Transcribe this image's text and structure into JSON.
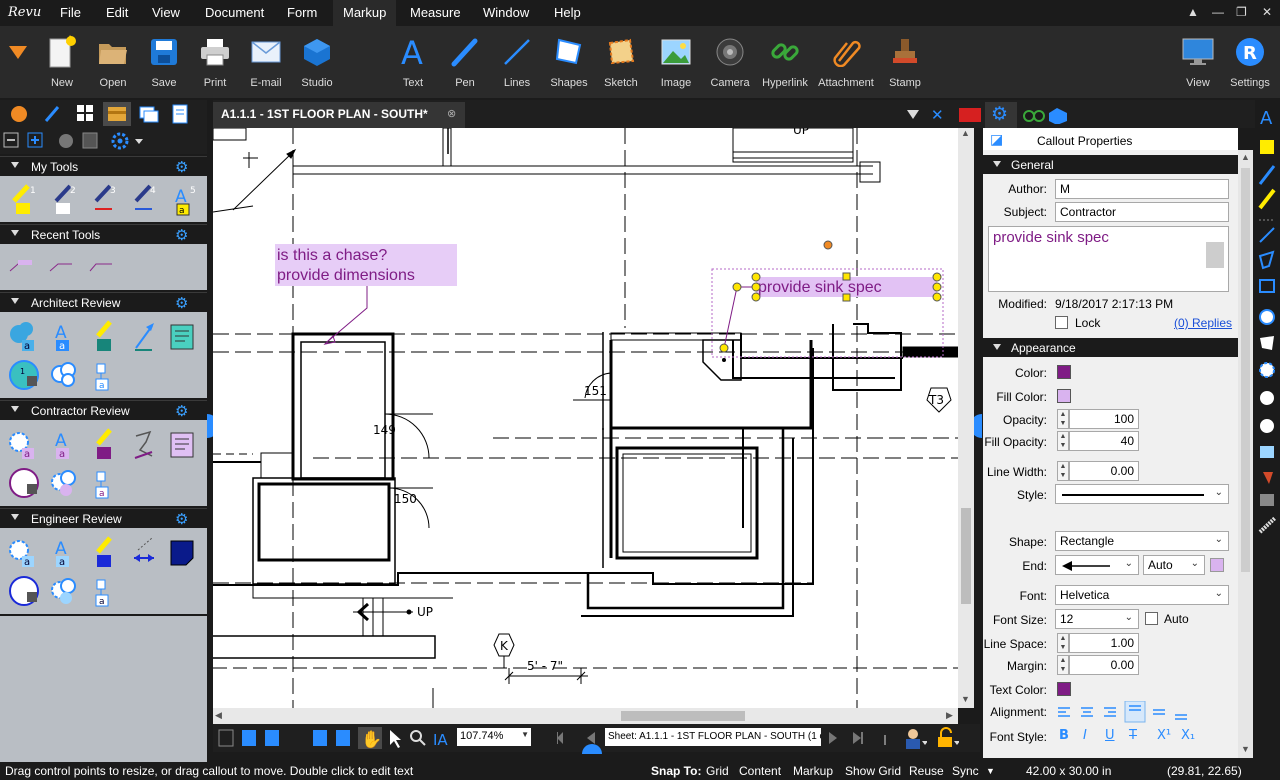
{
  "app": {
    "logo": "Revu"
  },
  "menu": [
    "File",
    "Edit",
    "View",
    "Document",
    "Form",
    "Markup",
    "Measure",
    "Window",
    "Help"
  ],
  "window_controls": [
    "▲",
    "—",
    "❐",
    "✕"
  ],
  "ribbon": {
    "left_tools": [
      {
        "label": "New",
        "icon": "new-document-icon"
      },
      {
        "label": "Open",
        "icon": "open-folder-icon"
      },
      {
        "label": "Save",
        "icon": "save-disk-icon"
      },
      {
        "label": "Print",
        "icon": "printer-icon"
      },
      {
        "label": "E-mail",
        "icon": "email-envelope-icon"
      },
      {
        "label": "Studio",
        "icon": "studio-cube-icon"
      }
    ],
    "markup_tools": [
      {
        "label": "Text",
        "icon": "text-a-icon"
      },
      {
        "label": "Pen",
        "icon": "pen-icon"
      },
      {
        "label": "Lines",
        "icon": "line-icon"
      },
      {
        "label": "Shapes",
        "icon": "shapes-icon"
      },
      {
        "label": "Sketch",
        "icon": "sketch-icon"
      },
      {
        "label": "Image",
        "icon": "image-icon"
      },
      {
        "label": "Camera",
        "icon": "camera-icon"
      },
      {
        "label": "Hyperlink",
        "icon": "hyperlink-icon"
      },
      {
        "label": "Attachment",
        "icon": "paperclip-icon"
      },
      {
        "label": "Stamp",
        "icon": "stamp-icon"
      }
    ],
    "right_tools": [
      {
        "label": "View",
        "icon": "monitor-icon"
      },
      {
        "label": "Settings",
        "icon": "settings-r-icon"
      }
    ]
  },
  "tool_chest": {
    "sections": [
      {
        "title": "My Tools",
        "badges": [
          "1",
          "2",
          "3",
          "4",
          "5"
        ]
      },
      {
        "title": "Recent Tools"
      },
      {
        "title": "Architect Review",
        "badges": [
          "a",
          "a",
          "1",
          "a"
        ]
      },
      {
        "title": "Contractor Review",
        "badges": [
          "a",
          "a",
          "a"
        ]
      },
      {
        "title": "Engineer Review",
        "badges": [
          "a",
          "a",
          "a"
        ]
      }
    ]
  },
  "document": {
    "tab_title": "A1.1.1 - 1ST FLOOR PLAN - SOUTH*",
    "markups": {
      "chase_note": [
        "is this a chase?",
        "provide dimensions"
      ],
      "callout": "provide sink spec"
    },
    "rooms": [
      "149",
      "150",
      "151"
    ],
    "tags": [
      "T3",
      "K"
    ],
    "dimension": "5' - 7\"",
    "up_labels": [
      "UP",
      "UP"
    ]
  },
  "bottom_toolbar": {
    "zoom": "107.74%",
    "sheet": "Sheet: A1.1.1 - 1ST FLOOR PLAN - SOUTH (1 of 1)"
  },
  "status": {
    "hint": "Drag control points to resize, or drag callout to move. Double click to edit text",
    "snap_to_label": "Snap To:",
    "snap_items": [
      "Grid",
      "Content",
      "Markup",
      "Show Grid",
      "Reuse",
      "Sync"
    ],
    "page_size": "42.00 x 30.00 in",
    "coords": "(29.81, 22.65)"
  },
  "properties": {
    "title": "Callout Properties",
    "general": {
      "header": "General",
      "author_label": "Author:",
      "author": "M",
      "subject_label": "Subject:",
      "subject": "Contractor",
      "comment": "provide sink spec",
      "modified_label": "Modified:",
      "modified": "9/18/2017 2:17:13 PM",
      "lock_label": "Lock",
      "replies": "(0) Replies"
    },
    "appearance": {
      "header": "Appearance",
      "color_label": "Color:",
      "color": "#7f1c85",
      "fill_color_label": "Fill Color:",
      "fill_color": "#d9b3ef",
      "opacity_label": "Opacity:",
      "opacity": "100",
      "fill_opacity_label": "Fill Opacity:",
      "fill_opacity": "40",
      "line_width_label": "Line Width:",
      "line_width": "0.00",
      "style_label": "Style:",
      "shape_label": "Shape:",
      "shape": "Rectangle",
      "end_label": "End:",
      "end_size": "Auto",
      "font_label": "Font:",
      "font": "Helvetica",
      "font_size_label": "Font Size:",
      "font_size": "12",
      "auto_label": "Auto",
      "line_space_label": "Line Space:",
      "line_space": "1.00",
      "margin_label": "Margin:",
      "margin": "0.00",
      "text_color_label": "Text Color:",
      "alignment_label": "Alignment:",
      "font_style_label": "Font Style:",
      "font_style_buttons": [
        "B",
        "I",
        "U",
        "T",
        "X¹",
        "X₁"
      ]
    }
  },
  "colors": {
    "accent": "#2a8cff",
    "markup": "#7f1c85",
    "markup_fill": "#d9b3ef",
    "highlight": "#ffec00"
  }
}
